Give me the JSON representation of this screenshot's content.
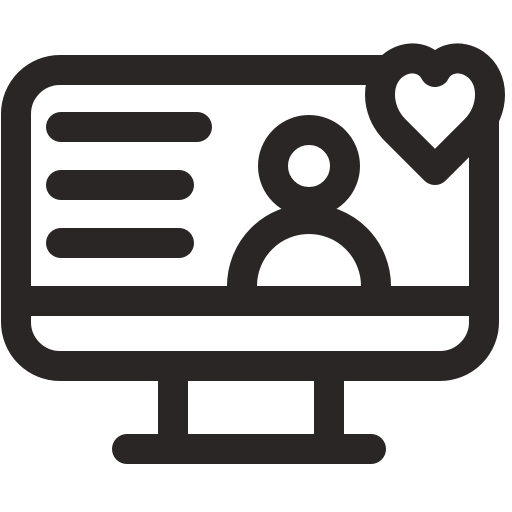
{
  "icon": {
    "name": "computer-monitor-profile-heart-icon",
    "stroke_color": "#2b2626",
    "fill_color": "#ffffff",
    "parts": [
      "monitor-frame",
      "screen-divider",
      "text-lines",
      "user-avatar",
      "heart",
      "monitor-stand",
      "monitor-base"
    ]
  }
}
